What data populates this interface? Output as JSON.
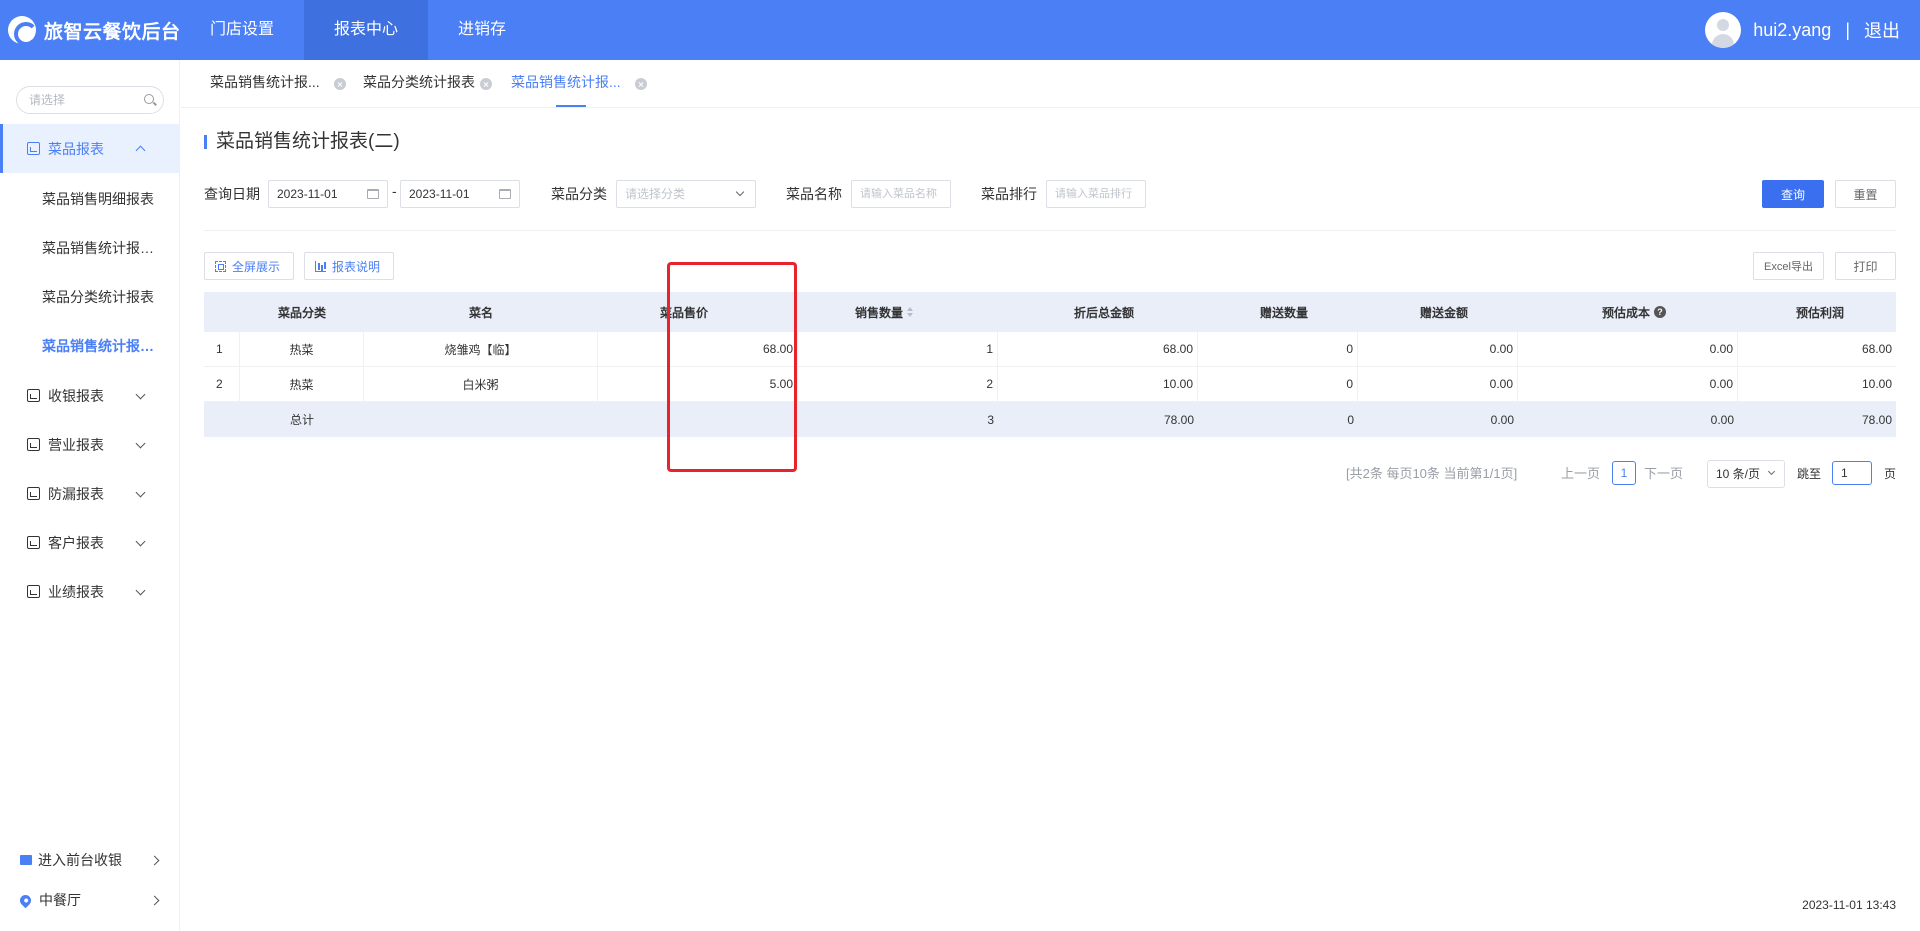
{
  "header": {
    "app_title": "旅智云餐饮后台",
    "nav": [
      {
        "label": "门店设置"
      },
      {
        "label": "报表中心"
      },
      {
        "label": "进销存"
      }
    ],
    "username": "hui2.yang",
    "separator": "|",
    "logout": "退出"
  },
  "sidebar": {
    "search_placeholder": "请选择",
    "groups": [
      {
        "label": "菜品报表",
        "icon": "report-icon"
      },
      {
        "label": "收银报表",
        "icon": "cashier-icon"
      },
      {
        "label": "营业报表",
        "icon": "business-icon"
      },
      {
        "label": "防漏报表",
        "icon": "leak-icon"
      },
      {
        "label": "客户报表",
        "icon": "customer-icon"
      },
      {
        "label": "业绩报表",
        "icon": "performance-icon"
      }
    ],
    "sub_items": [
      {
        "label": "菜品销售明细报表"
      },
      {
        "label": "菜品销售统计报表(二)"
      },
      {
        "label": "菜品分类统计报表"
      },
      {
        "label": "菜品销售统计报表(二)"
      }
    ],
    "bottom": {
      "front_cashier": "进入前台收银",
      "store": "中餐厅"
    }
  },
  "tabs": [
    {
      "label": "菜品销售统计报..."
    },
    {
      "label": "菜品分类统计报表"
    },
    {
      "label": "菜品销售统计报..."
    }
  ],
  "page": {
    "title": "菜品销售统计报表(二)",
    "filters": {
      "date_label": "查询日期",
      "date_start": "2023-11-01",
      "date_sep": "-",
      "date_end": "2023-11-01",
      "category_label": "菜品分类",
      "category_placeholder": "请选择分类",
      "name_label": "菜品名称",
      "name_placeholder": "请输入菜品名称",
      "rank_label": "菜品排行",
      "rank_placeholder": "请输入菜品排行"
    },
    "buttons": {
      "query": "查询",
      "reset": "重置",
      "fullscreen": "全屏展示",
      "report_desc": "报表说明",
      "excel": "Excel导出",
      "print": "打印"
    },
    "table": {
      "columns": [
        "菜品分类",
        "菜名",
        "菜品售价",
        "销售数量",
        "折后总金额",
        "赠送数量",
        "赠送金额",
        "预估成本",
        "预估利润"
      ],
      "rows": [
        {
          "idx": "1",
          "category": "热菜",
          "name": "烧雏鸡【临】",
          "price": "68.00",
          "qty": "1",
          "amount": "68.00",
          "gift_qty": "0",
          "gift_amount": "0.00",
          "cost": "0.00",
          "profit": "68.00"
        },
        {
          "idx": "2",
          "category": "热菜",
          "name": "白米粥",
          "price": "5.00",
          "qty": "2",
          "amount": "10.00",
          "gift_qty": "0",
          "gift_amount": "0.00",
          "cost": "0.00",
          "profit": "10.00"
        }
      ],
      "total": {
        "label": "总计",
        "qty": "3",
        "amount": "78.00",
        "gift_qty": "0",
        "gift_amount": "0.00",
        "cost": "0.00",
        "profit": "78.00"
      }
    },
    "pagination": {
      "summary": "[共2条 每页10条 当前第1/1页]",
      "prev": "上一页",
      "current": "1",
      "next": "下一页",
      "page_size": "10 条/页",
      "jump_label": "跳至",
      "jump_value": "1",
      "page_suffix": "页"
    },
    "timestamp": "2023-11-01 13:43"
  },
  "colors": {
    "primary": "#4a7ff5",
    "header_bg": "#4a7ff5",
    "table_head_bg": "#e9eef9",
    "highlight": "#e8232b"
  }
}
